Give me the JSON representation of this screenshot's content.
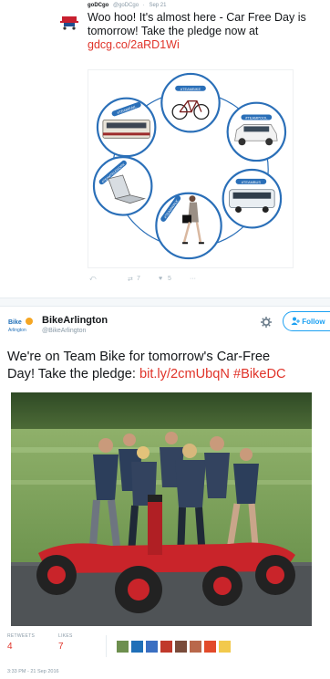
{
  "tweet1": {
    "name": "goDCgo",
    "handle": "@goDCgo",
    "date": "Sep 21",
    "text_prefix": "Woo hoo! It's almost here - Car Free Day is tomorrow! Take the pledge now at ",
    "link": "gdcg.co/2aRD1Wi",
    "badges": [
      "#TEAMBIKE",
      "#TEAMPOOL",
      "#TEAMBUS",
      "#TEAMWALK",
      "#TEAMTELEWORK",
      "#TEAMRAIL"
    ],
    "actions": {
      "retweet_count": "7",
      "like_count": "5",
      "more": "···"
    }
  },
  "tweet2": {
    "logo_top": "Bike",
    "logo_bottom": "Arlington",
    "name": "BikeArlington",
    "handle": "@BikeArlington",
    "follow_label": "Follow",
    "text_line1": "We're on Team Bike for tomorrow's Car-Free",
    "text_line2_prefix": "Day! Take the pledge: ",
    "text_link": "bit.ly/2cmUbqN #BikeDC",
    "retweets_label": "RETWEETS",
    "retweets_value": "4",
    "likes_label": "LIKES",
    "likes_value": "7",
    "timestamp": "3:33 PM - 21 Sep 2016"
  },
  "colors": {
    "link": "#e0342a",
    "follow": "#1da1f2",
    "badge_blue": "#2a6fb8",
    "bike_frame": "#d3232b"
  }
}
